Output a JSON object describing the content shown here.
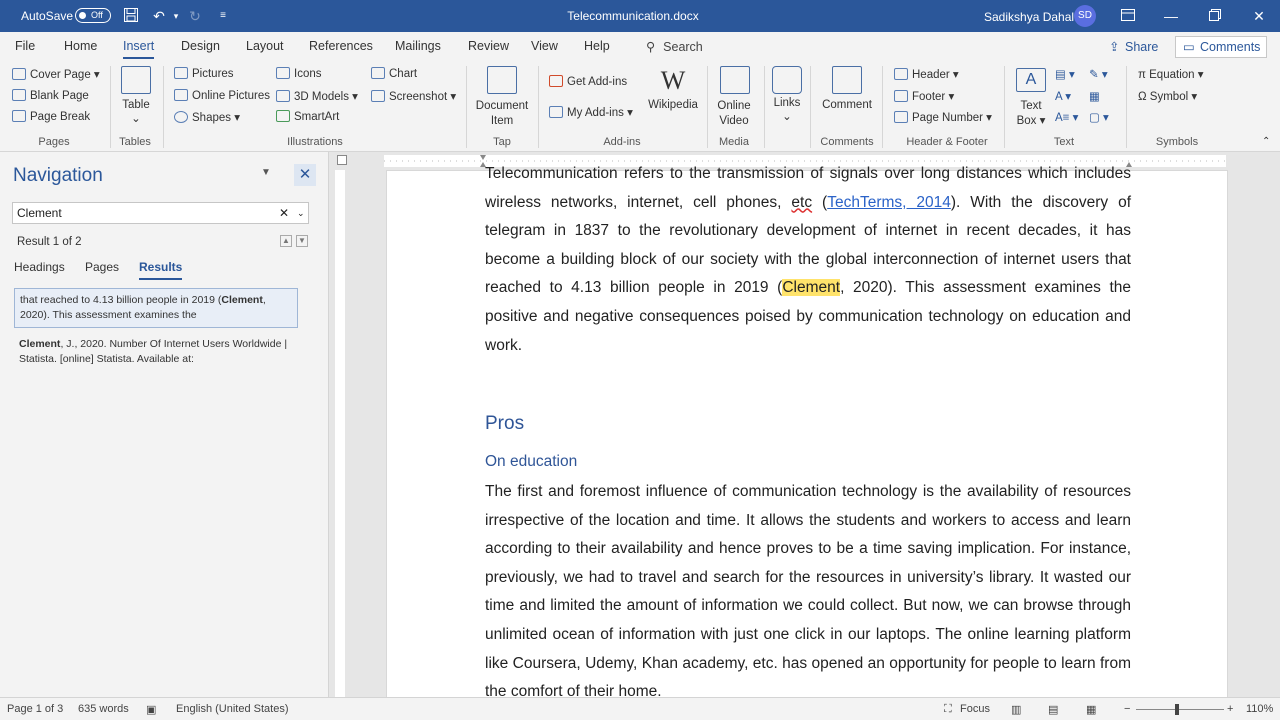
{
  "titlebar": {
    "autosave_label": "AutoSave",
    "autosave_state": "Off",
    "doc_title": "Telecommunication.docx",
    "user_name": "Sadikshya Dahal",
    "user_initials": "SD"
  },
  "menu": {
    "tabs": [
      "File",
      "Home",
      "Insert",
      "Design",
      "Layout",
      "References",
      "Mailings",
      "Review",
      "View",
      "Help"
    ],
    "active_tab": "Insert",
    "search_label": "Search",
    "share_label": "Share",
    "comments_label": "Comments"
  },
  "ribbon": {
    "pages": {
      "cover_page": "Cover Page",
      "blank_page": "Blank Page",
      "page_break": "Page Break",
      "label": "Pages"
    },
    "tables": {
      "table": "Table",
      "label": "Tables"
    },
    "illustrations": {
      "pictures": "Pictures",
      "online_pictures": "Online Pictures",
      "shapes": "Shapes",
      "icons": "Icons",
      "models_3d": "3D Models",
      "smartart": "SmartArt",
      "chart": "Chart",
      "screenshot": "Screenshot",
      "label": "Illustrations"
    },
    "tap": {
      "document_item_line1": "Document",
      "document_item_line2": "Item",
      "label": "Tap"
    },
    "addins": {
      "get_addins": "Get Add-ins",
      "my_addins": "My Add-ins",
      "wikipedia": "Wikipedia",
      "label": "Add-ins"
    },
    "media": {
      "online_video_line1": "Online",
      "online_video_line2": "Video",
      "label": "Media"
    },
    "links": {
      "links": "Links"
    },
    "comments": {
      "comment": "Comment",
      "label": "Comments"
    },
    "header_footer": {
      "header": "Header",
      "footer": "Footer",
      "page_number": "Page Number",
      "label": "Header & Footer"
    },
    "text": {
      "text_box_line1": "Text",
      "text_box_line2": "Box",
      "label": "Text"
    },
    "symbols": {
      "equation": "Equation",
      "symbol": "Symbol",
      "label": "Symbols"
    }
  },
  "navigation": {
    "title": "Navigation",
    "search_value": "Clement",
    "result_count": "Result 1 of 2",
    "tabs": [
      "Headings",
      "Pages",
      "Results"
    ],
    "active_tab": "Results",
    "results": [
      {
        "before": "that reached to 4.13 billion people in 2019 (",
        "match": "Clement",
        "after": ", 2020). This assessment examines the"
      },
      {
        "before": "",
        "match": "Clement",
        "after": ", J., 2020. Number Of Internet Users Worldwide | Statista. [online] Statista. Available at:"
      }
    ]
  },
  "document": {
    "para1": {
      "line_top": "Telecommunication refers to the transmission of signals over long distances which includes wireless networks, internet, cell phones, ",
      "etc": "etc",
      "link_open": " (",
      "link_text": "TechTerms, 2014",
      "after_link": "). With the discovery of telegram in 1837 to the revolutionary development of internet in recent decades, it has become a building block of our society with the global interconnection of internet users that reached to 4.13 billion people in 2019 (",
      "highlight": "Clement",
      "after_highlight": ", 2020). This assessment examines the positive and negative consequences poised by communication technology on education and work."
    },
    "heading_pros": "Pros",
    "heading_on_education": "On education",
    "para2": "The first and foremost influence of communication technology is the availability of resources irrespective of the location and time. It allows the students and workers to access and learn according to their availability and hence proves to be a time saving implication. For instance, previously, we had to travel and search for the resources in university’s library. It wasted our time and limited the amount of information we could collect. But now, we can browse through unlimited ocean of information with just one click in our laptops. The online learning platform like Coursera, Udemy, Khan academy, etc. has opened an opportunity for people to learn from the comfort of their home."
  },
  "statusbar": {
    "page": "Page 1 of 3",
    "words": "635 words",
    "language": "English (United States)",
    "focus": "Focus",
    "zoom": "110%",
    "zoom_minus": "−",
    "zoom_plus": "+"
  },
  "colors": {
    "accent": "#2b579a",
    "highlight": "#ffe36b",
    "heading": "#2f5597",
    "link": "#2b63c8"
  }
}
